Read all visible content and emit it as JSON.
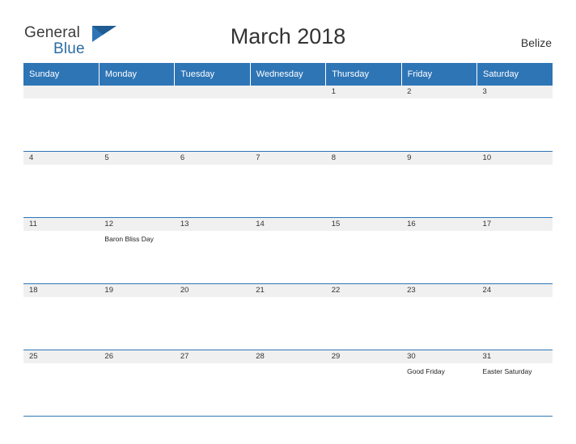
{
  "brand": {
    "line1": "General",
    "line2": "Blue",
    "flag_icon": "blue-flag-logo-icon"
  },
  "header": {
    "title": "March 2018",
    "country": "Belize"
  },
  "calendar": {
    "weekday_headers": [
      "Sunday",
      "Monday",
      "Tuesday",
      "Wednesday",
      "Thursday",
      "Friday",
      "Saturday"
    ],
    "weeks": [
      [
        {
          "num": "",
          "event": "",
          "blank": true
        },
        {
          "num": "",
          "event": "",
          "blank": true
        },
        {
          "num": "",
          "event": "",
          "blank": true
        },
        {
          "num": "",
          "event": "",
          "blank": true
        },
        {
          "num": "1",
          "event": ""
        },
        {
          "num": "2",
          "event": ""
        },
        {
          "num": "3",
          "event": ""
        }
      ],
      [
        {
          "num": "4",
          "event": ""
        },
        {
          "num": "5",
          "event": ""
        },
        {
          "num": "6",
          "event": ""
        },
        {
          "num": "7",
          "event": ""
        },
        {
          "num": "8",
          "event": ""
        },
        {
          "num": "9",
          "event": ""
        },
        {
          "num": "10",
          "event": ""
        }
      ],
      [
        {
          "num": "11",
          "event": ""
        },
        {
          "num": "12",
          "event": "Baron Bliss Day"
        },
        {
          "num": "13",
          "event": ""
        },
        {
          "num": "14",
          "event": ""
        },
        {
          "num": "15",
          "event": ""
        },
        {
          "num": "16",
          "event": ""
        },
        {
          "num": "17",
          "event": ""
        }
      ],
      [
        {
          "num": "18",
          "event": ""
        },
        {
          "num": "19",
          "event": ""
        },
        {
          "num": "20",
          "event": ""
        },
        {
          "num": "21",
          "event": ""
        },
        {
          "num": "22",
          "event": ""
        },
        {
          "num": "23",
          "event": ""
        },
        {
          "num": "24",
          "event": ""
        }
      ],
      [
        {
          "num": "25",
          "event": ""
        },
        {
          "num": "26",
          "event": ""
        },
        {
          "num": "27",
          "event": ""
        },
        {
          "num": "28",
          "event": ""
        },
        {
          "num": "29",
          "event": ""
        },
        {
          "num": "30",
          "event": "Good Friday"
        },
        {
          "num": "31",
          "event": "Easter Saturday"
        }
      ]
    ]
  },
  "colors": {
    "header_band": "#2e75b6",
    "daynum_band": "#f0f0f0",
    "brand_blue": "#2b6ca3",
    "text": "#333333"
  }
}
